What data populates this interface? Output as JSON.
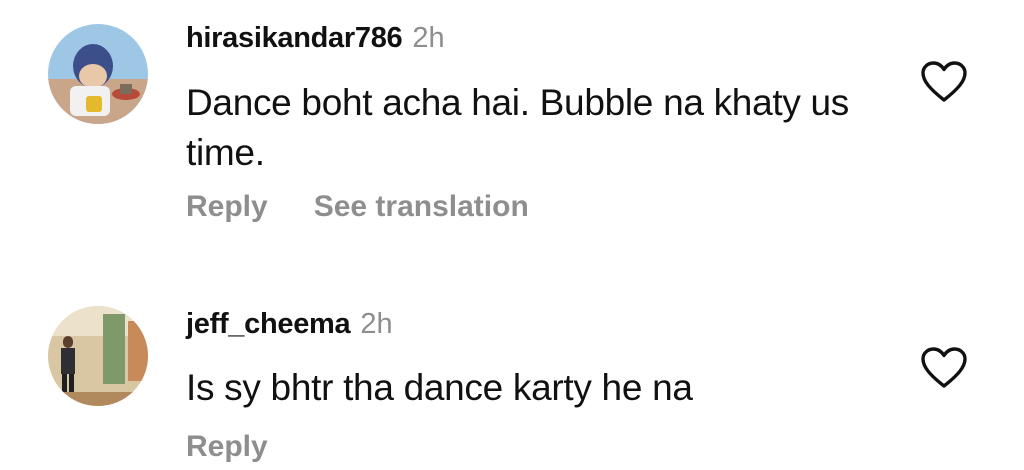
{
  "comments": [
    {
      "username": "hirasikandar786",
      "time": "2h",
      "text": "Dance boht acha hai. Bubble na khaty us time.",
      "reply_label": "Reply",
      "translation_label": "See translation"
    },
    {
      "username": "jeff_cheema",
      "time": "2h",
      "text": "Is sy bhtr tha dance karty he na",
      "reply_label": "Reply"
    }
  ],
  "icons": {
    "like": "heart-outline-icon"
  },
  "colors": {
    "text": "#111111",
    "secondary": "#8e8e8e",
    "background": "#ffffff"
  }
}
